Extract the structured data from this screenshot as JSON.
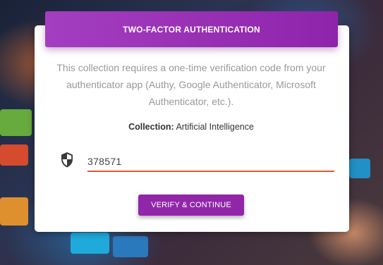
{
  "dialog": {
    "title": "TWO-FACTOR AUTHENTICATION",
    "description": "This collection requires a one-time verification code from your authenticator app (Authy, Google Authenticator, Microsoft Authenticator, etc.).",
    "collection_label": "Collection:",
    "collection_name": "Artificial Intelligence",
    "code_value": "378571",
    "verify_button_label": "VERIFY & CONTINUE",
    "shield_icon": "shield-icon"
  },
  "colors": {
    "header_purple": "#9c35b8",
    "button_purple": "#9127a8",
    "input_underline": "#e4572e"
  }
}
